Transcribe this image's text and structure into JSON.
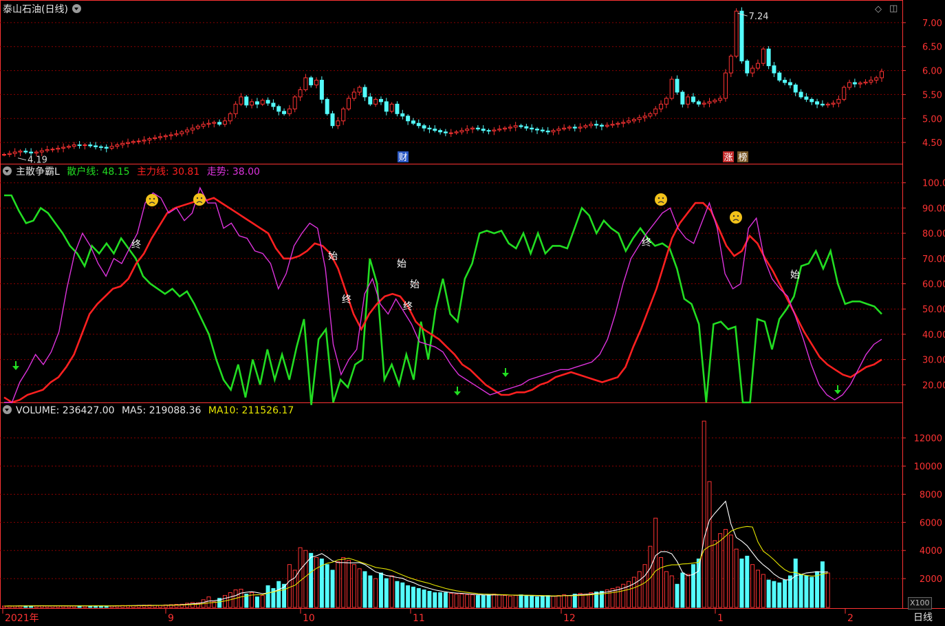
{
  "title": "泰山石油(日线)",
  "period_label": "日线",
  "colors": {
    "up": "#ff3333",
    "down": "#54fcfc",
    "green": "#22dd22",
    "red": "#ff2020",
    "magenta": "#dd33dd",
    "grid": "#8b0000",
    "ma5": "#ffffff",
    "ma10": "#e6e600"
  },
  "price_panel": {
    "high_label": "7.24",
    "low_label": "4.19",
    "markers": [
      "财",
      "涨",
      "榜"
    ],
    "axis_ticks": [
      "7.00",
      "6.50",
      "6.00",
      "5.50",
      "5.00",
      "4.50"
    ]
  },
  "indicator_panel": {
    "name": "主散争霸L",
    "retail": {
      "label": "散户线",
      "value": "48.15"
    },
    "main": {
      "label": "主力线",
      "value": "30.81"
    },
    "trend": {
      "label": "走势",
      "value": "38.00"
    },
    "signals": {
      "end": "终",
      "start": "始"
    },
    "axis_ticks": [
      "100.0",
      "90.00",
      "80.00",
      "70.00",
      "60.00",
      "50.00",
      "40.00",
      "30.00",
      "20.00"
    ]
  },
  "volume_panel": {
    "volume": {
      "label": "VOLUME",
      "value": "236427.00"
    },
    "ma5": {
      "label": "MA5",
      "value": "219088.36"
    },
    "ma10": {
      "label": "MA10",
      "value": "211526.17"
    },
    "unit": "X100",
    "axis_ticks": [
      "12000",
      "10000",
      "8000",
      "6000",
      "4000",
      "2000"
    ]
  },
  "x_axis": {
    "labels": [
      "2021年",
      "9",
      "10",
      "11",
      "12",
      "1",
      "2"
    ]
  },
  "chart_data": [
    {
      "type": "candlestick",
      "title": "泰山石油(日线)",
      "ylim": [
        4.2,
        7.3
      ],
      "close": [
        4.25,
        4.27,
        4.3,
        4.32,
        4.3,
        4.28,
        4.3,
        4.33,
        4.35,
        4.36,
        4.38,
        4.4,
        4.42,
        4.45,
        4.44,
        4.45,
        4.43,
        4.41,
        4.4,
        4.38,
        4.42,
        4.45,
        4.48,
        4.5,
        4.52,
        4.53,
        4.55,
        4.58,
        4.6,
        4.62,
        4.64,
        4.66,
        4.68,
        4.72,
        4.76,
        4.8,
        4.84,
        4.88,
        4.9,
        4.92,
        4.88,
        4.95,
        5.1,
        5.3,
        5.45,
        5.28,
        5.35,
        5.3,
        5.38,
        5.32,
        5.25,
        5.15,
        5.1,
        5.2,
        5.45,
        5.6,
        5.85,
        5.7,
        5.8,
        5.4,
        5.1,
        4.85,
        4.95,
        5.2,
        5.42,
        5.55,
        5.65,
        5.45,
        5.3,
        5.4,
        5.35,
        5.15,
        5.3,
        5.1,
        5.05,
        4.95,
        4.9,
        4.85,
        4.8,
        4.78,
        4.75,
        4.72,
        4.7,
        4.7,
        4.72,
        4.75,
        4.78,
        4.8,
        4.78,
        4.75,
        4.74,
        4.76,
        4.78,
        4.8,
        4.82,
        4.85,
        4.83,
        4.8,
        4.78,
        4.76,
        4.74,
        4.72,
        4.75,
        4.78,
        4.8,
        4.82,
        4.8,
        4.82,
        4.85,
        4.88,
        4.86,
        4.84,
        4.86,
        4.88,
        4.9,
        4.92,
        4.95,
        4.98,
        5.02,
        5.05,
        5.1,
        5.2,
        5.3,
        5.42,
        5.82,
        5.55,
        5.3,
        5.45,
        5.35,
        5.3,
        5.32,
        5.35,
        5.38,
        5.42,
        5.95,
        6.3,
        7.24,
        6.2,
        5.95,
        6.05,
        6.15,
        6.45,
        6.1,
        5.95,
        5.8,
        5.75,
        5.7,
        5.55,
        5.45,
        5.4,
        5.35,
        5.3,
        5.28,
        5.3,
        5.32,
        5.4,
        5.65,
        5.75,
        5.72,
        5.74,
        5.76,
        5.8,
        5.85,
        5.98
      ],
      "volume": [
        50,
        60,
        55,
        70,
        65,
        60,
        75,
        80,
        60,
        70,
        65,
        60,
        55,
        65,
        70,
        60,
        55,
        60,
        65,
        55,
        70,
        80,
        90,
        85,
        80,
        100,
        110,
        120,
        100,
        90,
        130,
        150,
        170,
        180,
        250,
        300,
        280,
        500,
        700,
        350,
        600,
        800,
        1000,
        1200,
        1250,
        900,
        1000,
        700,
        800,
        1500,
        1300,
        1800,
        1600,
        3000,
        2600,
        4200,
        4000,
        3800,
        3500,
        3400,
        3000,
        2600,
        3200,
        3500,
        3300,
        3000,
        2700,
        2500,
        2200,
        2000,
        2400,
        2000,
        2200,
        1800,
        1700,
        1500,
        1400,
        1300,
        1200,
        1100,
        1000,
        1000,
        1000,
        950,
        900,
        900,
        850,
        850,
        800,
        800,
        850,
        900,
        850,
        800,
        750,
        800,
        850,
        800,
        750,
        700,
        750,
        800,
        750,
        800,
        850,
        800,
        900,
        950,
        900,
        1000,
        1050,
        1100,
        1200,
        1300,
        1400,
        1600,
        1800,
        2100,
        2500,
        3000,
        4300,
        6300,
        3500,
        2500,
        2200,
        1600,
        2400,
        2300,
        3000,
        3400,
        13200,
        8900,
        4700,
        5200,
        5500,
        5100,
        4100,
        3400,
        3600,
        3000,
        2600,
        2300,
        1900,
        1800,
        1700,
        1900,
        2200,
        3400,
        2300,
        2200,
        2100,
        2500,
        3200,
        2400
      ]
    },
    {
      "type": "line",
      "title": "主散争霸L",
      "ylim": [
        13,
        107
      ],
      "series": [
        {
          "name": "散户线",
          "values": [
            95,
            95,
            89,
            84,
            85,
            90,
            88,
            84,
            80,
            75,
            72,
            67,
            75,
            72,
            76,
            72,
            78,
            74,
            70,
            63,
            60,
            58,
            56,
            58,
            55,
            57,
            52,
            46,
            40,
            30,
            22,
            18,
            28,
            15,
            30,
            20,
            34,
            22,
            32,
            22,
            35,
            46,
            12,
            38,
            42,
            13,
            22,
            19,
            28,
            30,
            70,
            60,
            22,
            28,
            20,
            32,
            22,
            45,
            30,
            50,
            62,
            48,
            45,
            62,
            68,
            80,
            81,
            80,
            81,
            76,
            74,
            80,
            72,
            80,
            72,
            75,
            75,
            74,
            82,
            90,
            87,
            80,
            85,
            82,
            80,
            73,
            78,
            82,
            78,
            75,
            76,
            74,
            66,
            54,
            52,
            44,
            13,
            44,
            45,
            42,
            43,
            13,
            13,
            46,
            45,
            34,
            46,
            50,
            55,
            67,
            68,
            73,
            66,
            73,
            60,
            52,
            53,
            53,
            52,
            51,
            48
          ]
        },
        {
          "name": "主力线",
          "values": [
            15,
            13,
            14,
            16,
            17,
            18,
            21,
            23,
            27,
            32,
            40,
            48,
            52,
            55,
            58,
            59,
            62,
            68,
            72,
            78,
            83,
            88,
            90,
            91,
            92,
            93,
            93,
            94,
            92,
            90,
            88,
            86,
            84,
            82,
            80,
            74,
            70,
            70,
            71,
            73,
            76,
            75,
            72,
            66,
            57,
            48,
            42,
            48,
            52,
            55,
            56,
            55,
            51,
            45,
            42,
            40,
            38,
            35,
            32,
            28,
            26,
            23,
            20,
            18,
            16,
            16,
            17,
            17,
            18,
            20,
            21,
            23,
            24,
            25,
            24,
            23,
            22,
            21,
            22,
            23,
            27,
            35,
            42,
            50,
            58,
            68,
            78,
            84,
            88,
            92,
            92,
            89,
            82,
            75,
            71,
            73,
            79,
            76,
            70,
            65,
            59,
            53,
            47,
            41,
            36,
            31,
            28,
            26,
            24,
            23,
            25,
            27,
            28,
            30
          ]
        },
        {
          "name": "走势",
          "values": [
            13,
            13,
            21,
            26,
            32,
            28,
            33,
            41,
            58,
            72,
            80,
            75,
            68,
            63,
            70,
            68,
            74,
            80,
            92,
            96,
            94,
            88,
            90,
            85,
            88,
            98,
            92,
            92,
            82,
            84,
            79,
            78,
            73,
            72,
            68,
            58,
            64,
            75,
            80,
            84,
            82,
            66,
            36,
            24,
            30,
            34,
            56,
            62,
            52,
            48,
            54,
            49,
            44,
            37,
            36,
            35,
            33,
            28,
            24,
            22,
            20,
            18,
            16,
            17,
            18,
            19,
            20,
            22,
            23,
            24,
            25,
            26,
            26,
            27,
            28,
            29,
            32,
            38,
            48,
            60,
            70,
            75,
            80,
            84,
            88,
            90,
            82,
            78,
            76,
            84,
            92,
            82,
            64,
            58,
            60,
            82,
            86,
            70,
            62,
            58,
            55,
            47,
            38,
            28,
            20,
            16,
            14,
            16,
            20,
            26,
            32,
            36,
            38
          ]
        }
      ]
    },
    {
      "type": "bar",
      "title": "VOLUME",
      "ylim": [
        0,
        13500
      ],
      "series": [
        {
          "name": "VOLUME"
        },
        {
          "name": "MA5"
        },
        {
          "name": "MA10"
        }
      ]
    }
  ]
}
